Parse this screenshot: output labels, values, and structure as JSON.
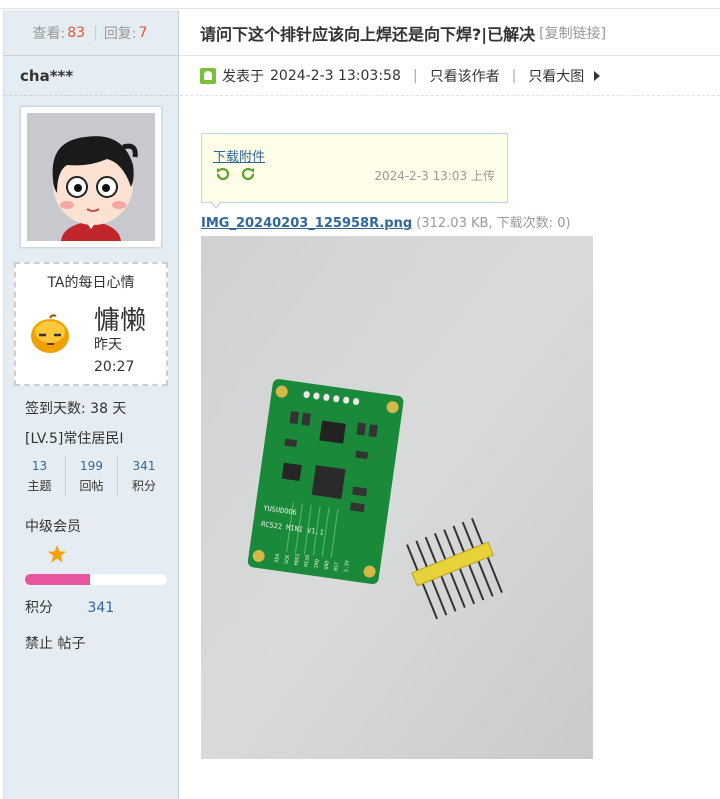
{
  "thread": {
    "views_label": "查看:",
    "views": "83",
    "replies_label": "回复:",
    "replies": "7",
    "title": "请问下这个排针应该向上焊还是向下焊?|已解决",
    "copy_link": "[复制链接]"
  },
  "author": {
    "name": "cha***",
    "mood_title": "TA的每日心情",
    "mood_word": "慵懒",
    "mood_time": "昨天 20:27",
    "signin": "签到天数: 38 天",
    "level": "[LV.5]常住居民I",
    "stats": [
      {
        "value": "13",
        "label": "主题"
      },
      {
        "value": "199",
        "label": "回帖"
      },
      {
        "value": "341",
        "label": "积分"
      }
    ],
    "rank": "中级会员",
    "progress": 0.46,
    "points_label": "积分",
    "points": "341",
    "ban_label": "禁止",
    "posts_label": "帖子"
  },
  "post": {
    "posted_label": "发表于",
    "posted_time": "2024-2-3 13:03:58",
    "author_only": "只看该作者",
    "big_image": "只看大图"
  },
  "attachment": {
    "download_label": "下载附件",
    "upload_time": "2024-2-3 13:03 上传",
    "filename": "IMG_20240203_125958R.png",
    "file_info": "(312.03 KB, 下载次数: 0)"
  },
  "board_text": {
    "model": "YUSUDOO6",
    "name": "RC522 MINI V1.1",
    "pins": [
      "SDA",
      "SCK",
      "MOSI",
      "MISO",
      "IRQ",
      "GND",
      "RST",
      "3.3V"
    ]
  },
  "colors": {
    "link": "#336699",
    "count": "#e45a3c",
    "sidebar": "#e5edf2",
    "progress": "#e8559f",
    "pcb": "#1a8a3a"
  }
}
